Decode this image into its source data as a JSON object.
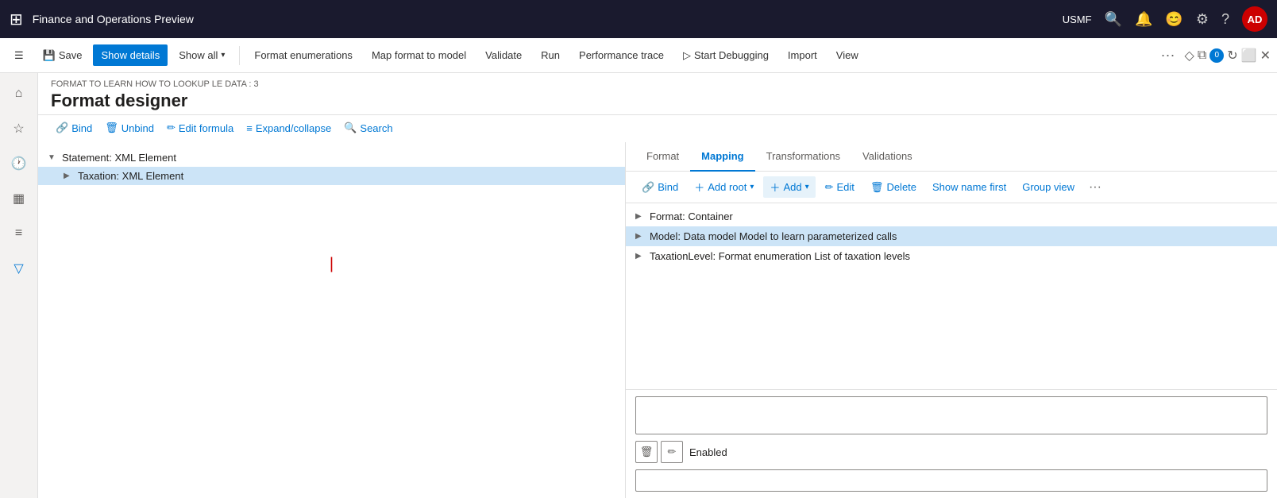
{
  "topbar": {
    "app_title": "Finance and Operations Preview",
    "user_label": "USMF",
    "avatar_text": "AD"
  },
  "commandbar": {
    "save_label": "Save",
    "show_details_label": "Show details",
    "show_all_label": "Show all",
    "format_enumerations_label": "Format enumerations",
    "map_format_label": "Map format to model",
    "validate_label": "Validate",
    "run_label": "Run",
    "performance_trace_label": "Performance trace",
    "start_debugging_label": "Start Debugging",
    "import_label": "Import",
    "view_label": "View"
  },
  "page": {
    "breadcrumb": "FORMAT TO LEARN HOW TO LOOKUP LE DATA : 3",
    "title": "Format designer"
  },
  "toolbar": {
    "bind_label": "Bind",
    "unbind_label": "Unbind",
    "edit_formula_label": "Edit formula",
    "expand_collapse_label": "Expand/collapse",
    "search_label": "Search"
  },
  "tree": {
    "items": [
      {
        "label": "Statement: XML Element",
        "level": 0,
        "chevron": "▼",
        "selected": false
      },
      {
        "label": "Taxation: XML Element",
        "level": 1,
        "chevron": "▶",
        "selected": true
      }
    ]
  },
  "mapping": {
    "tabs": [
      {
        "label": "Format",
        "active": false
      },
      {
        "label": "Mapping",
        "active": true
      },
      {
        "label": "Transformations",
        "active": false
      },
      {
        "label": "Validations",
        "active": false
      }
    ],
    "toolbar": {
      "bind_label": "Bind",
      "add_root_label": "Add root",
      "add_label": "Add",
      "edit_label": "Edit",
      "delete_label": "Delete",
      "show_name_first_label": "Show name first",
      "group_view_label": "Group view"
    },
    "tree_items": [
      {
        "label": "Format: Container",
        "chevron": "▶",
        "highlighted": false
      },
      {
        "label": "Model: Data model Model to learn parameterized calls",
        "chevron": "▶",
        "highlighted": true
      },
      {
        "label": "TaxationLevel: Format enumeration List of taxation levels",
        "chevron": "▶",
        "highlighted": false
      }
    ],
    "bottom": {
      "enabled_label": "Enabled"
    }
  }
}
